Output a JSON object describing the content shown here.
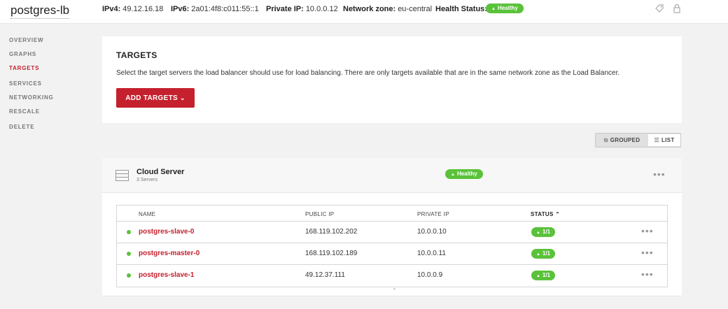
{
  "header": {
    "title": "postgres-lb",
    "ipv4_label": "IPv4:",
    "ipv4_value": "49.12.16.18",
    "ipv6_label": "IPv6:",
    "ipv6_value": "2a01:4f8:c011:55::1",
    "private_ip_label": "Private IP:",
    "private_ip_value": "10.0.0.12",
    "network_zone_label": "Network zone:",
    "network_zone_value": "eu-central",
    "health_label": "Health Status:",
    "health_value": "Healthy",
    "icons": [
      "tag-icon",
      "lock-icon"
    ]
  },
  "sidebar": {
    "items": [
      {
        "label": "OVERVIEW",
        "active": false
      },
      {
        "label": "GRAPHS",
        "active": false
      },
      {
        "label": "TARGETS",
        "active": true
      },
      {
        "label": "SERVICES",
        "active": false
      },
      {
        "label": "NETWORKING",
        "active": false
      },
      {
        "label": "RESCALE",
        "active": false
      },
      {
        "label": "DELETE",
        "active": false
      }
    ]
  },
  "targets": {
    "title": "TARGETS",
    "description": "Select the target servers the load balancer should use for load balancing. There are only targets available that are in the same network zone as the Load Balancer.",
    "add_button": "ADD TARGETS"
  },
  "view_toggle": {
    "grouped": "GROUPED",
    "list": "LIST",
    "selected": "LIST"
  },
  "group": {
    "name": "Cloud Server",
    "count": "3 Servers",
    "status": "Healthy"
  },
  "table": {
    "headers": {
      "name": "NAME",
      "public_ip": "PUBLIC IP",
      "private_ip": "PRIVATE IP",
      "status": "STATUS"
    },
    "sort": {
      "column": "STATUS",
      "direction": "ascending"
    },
    "rows": [
      {
        "name": "postgres-slave-0",
        "public_ip": "168.119.102.202",
        "private_ip": "10.0.0.10",
        "status": "1/1"
      },
      {
        "name": "postgres-master-0",
        "public_ip": "168.119.102.189",
        "private_ip": "10.0.0.11",
        "status": "1/1"
      },
      {
        "name": "postgres-slave-1",
        "public_ip": "49.12.37.111",
        "private_ip": "10.0.0.9",
        "status": "1/1"
      }
    ]
  },
  "colors": {
    "accent": "#c5202e",
    "healthy": "#5ac23a"
  }
}
